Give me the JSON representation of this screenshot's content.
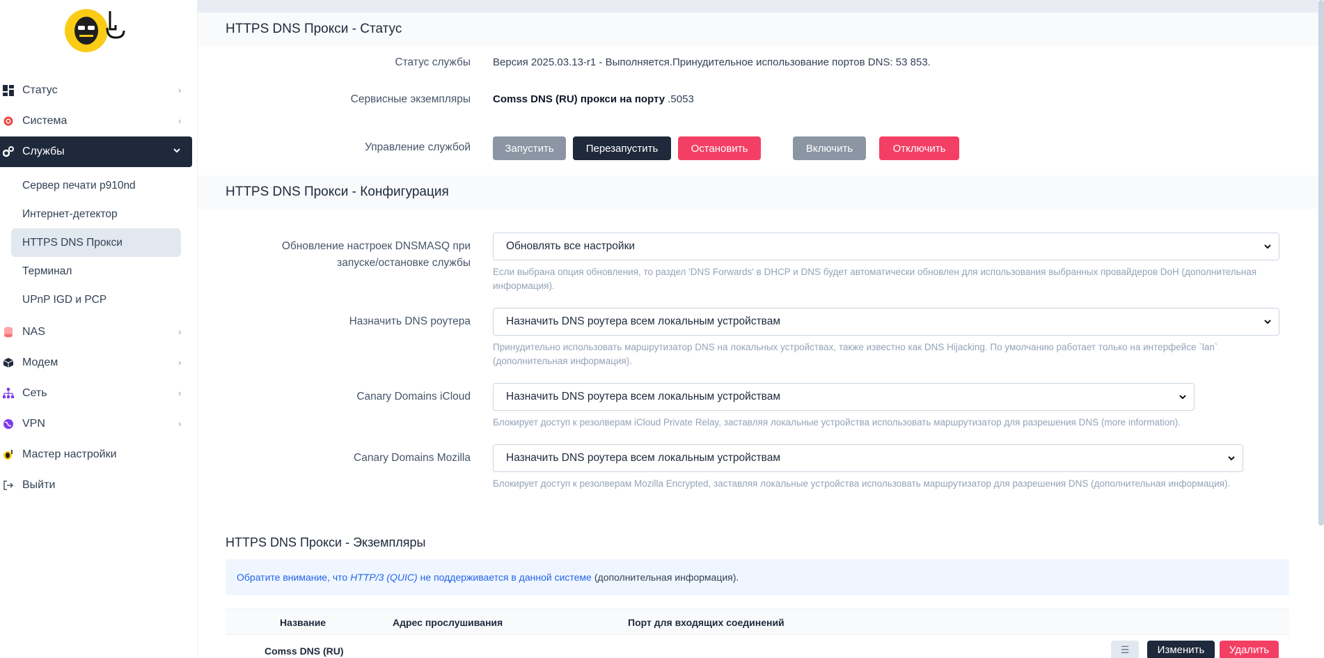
{
  "sidebar": {
    "items": [
      {
        "label": "Статус",
        "icon": "dashboard-icon"
      },
      {
        "label": "Система",
        "icon": "gear-icon"
      },
      {
        "label": "Службы",
        "icon": "services-icon"
      },
      {
        "label": "NAS",
        "icon": "database-icon"
      },
      {
        "label": "Модем",
        "icon": "cube-icon"
      },
      {
        "label": "Сеть",
        "icon": "network-icon"
      },
      {
        "label": "VPN",
        "icon": "globe-icon"
      },
      {
        "label": "Мастер настройки",
        "icon": "wizard-icon"
      },
      {
        "label": "Выйти",
        "icon": "logout-icon"
      }
    ],
    "sub_items": [
      {
        "label": "Сервер печати p910nd"
      },
      {
        "label": "Интернет-детектор"
      },
      {
        "label": "HTTPS DNS Прокси"
      },
      {
        "label": "Терминал"
      },
      {
        "label": "UPnP IGD и PCP"
      }
    ]
  },
  "status": {
    "title": "HTTPS DNS Прокси - Статус",
    "service_status_label": "Статус службы",
    "service_status_value": "Версия 2025.03.13-r1 - Выполняется.Принудительное использование портов DNS: 53 853.",
    "instances_label": "Сервисные экземпляры",
    "instances_bold": "Comss DNS (RU) прокси на порту",
    "instances_port": ".5053",
    "control_label": "Управление службой",
    "buttons": {
      "start": "Запустить",
      "restart": "Перезапустить",
      "stop": "Остановить",
      "enable": "Включить",
      "disable": "Отключить"
    }
  },
  "config": {
    "title": "HTTPS DNS Прокси - Конфигурация",
    "dnsmasq_label": "Обновление настроек DNSMASQ при запуске/остановке службы",
    "dnsmasq_value": "Обновлять все настройки",
    "dnsmasq_hint": "Если выбрана опция обновления, то раздел 'DNS Forwards' в DHCP и DNS будет автоматически обновлен для использования выбранных провайдеров DoH (дополнительная информация).",
    "router_dns_label": "Назначить DNS роутера",
    "router_dns_value": "Назначить DNS роутера всем локальным устройствам",
    "router_dns_hint": "Принудительно использовать маршрутизатор DNS на локальных устройствах, также известно как DNS Hijacking. По умолчанию работает только на интерфейсе `lan` (дополнительная информация).",
    "icloud_label": "Canary Domains iCloud",
    "icloud_value": "Назначить DNS роутера всем локальным устройствам",
    "icloud_hint": "Блокирует доступ к резолверам iCloud Private Relay, заставляя локальные устройства использовать маршрутизатор для разрешения DNS (more information).",
    "mozilla_label": "Canary Domains Mozilla",
    "mozilla_value": "Назначить DNS роутера всем локальным устройствам",
    "mozilla_hint": "Блокирует доступ к резолверам Mozilla Encrypted, заставляя локальные устройства использовать маршрутизатор для разрешения DNS (дополнительная информация)."
  },
  "instances": {
    "title": "HTTPS DNS Прокси - Экземпляры",
    "notice_prefix": "Обратите внимание, что ",
    "notice_italic": "HTTP/3 (QUIC)",
    "notice_middle": " не поддерживается в данной системе",
    "notice_suffix": " (дополнительная информация).",
    "columns": [
      "Название",
      "Адрес прослушивания",
      "Порт для входящих соединений"
    ],
    "row_name": "Comss DNS (RU)",
    "edit_label": "Изменить",
    "delete_label": "Удалить"
  }
}
